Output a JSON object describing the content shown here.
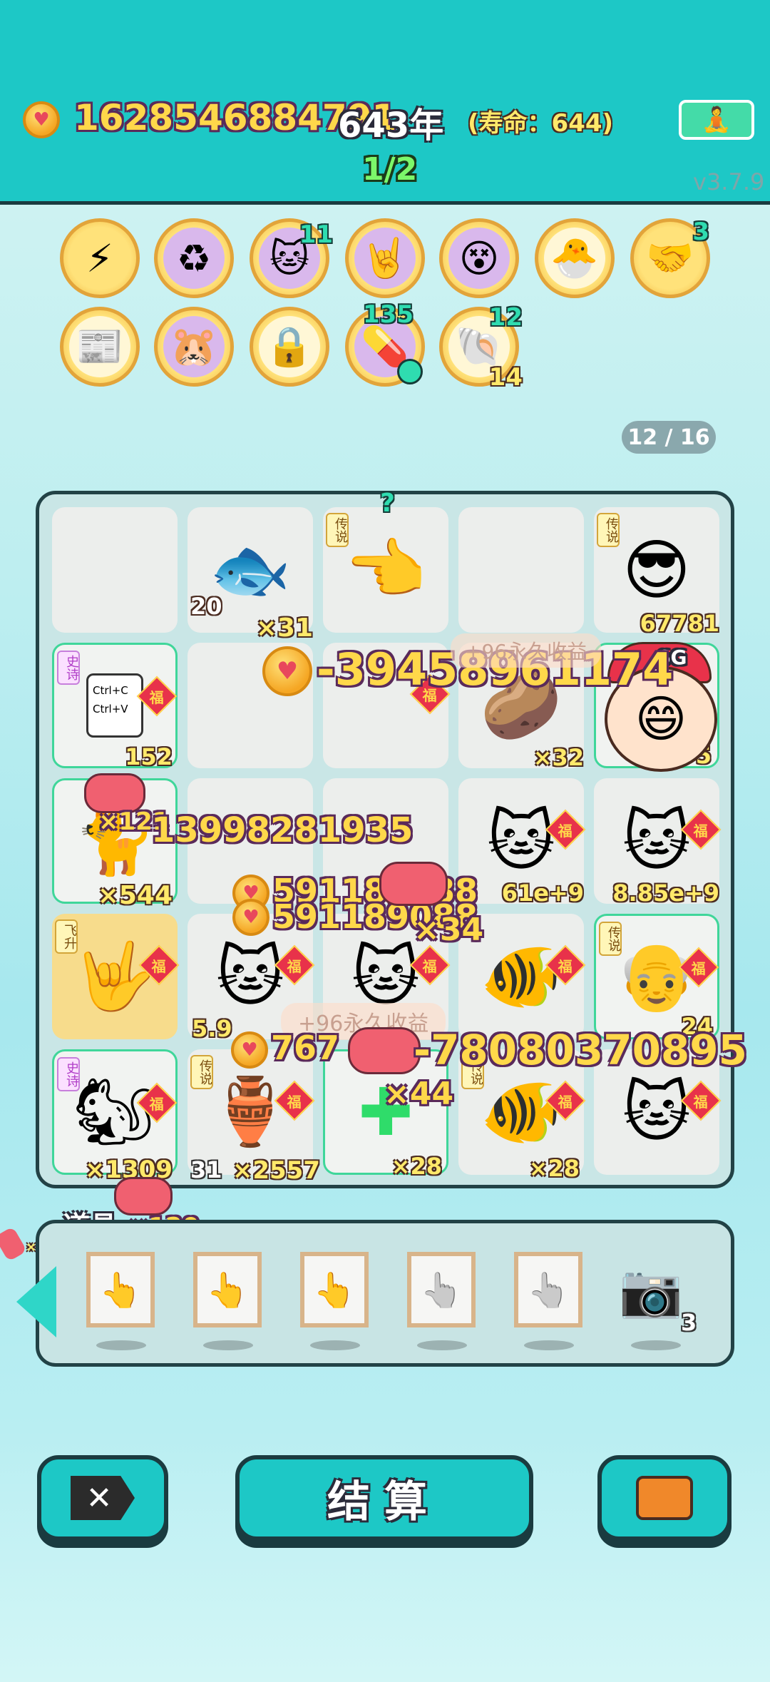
{
  "header": {
    "coins": "1628546884791",
    "years": "643年",
    "lifespan": "(寿命：644)",
    "progress": "1/2",
    "version": "v3.7.9",
    "meditate_icon": "meditate-icon"
  },
  "relics": {
    "row1": [
      {
        "icon": "lightning-icon",
        "count": ""
      },
      {
        "icon": "recycle-icon",
        "count": ""
      },
      {
        "icon": "cat-icon",
        "count": "11"
      },
      {
        "icon": "rock-hand-icon",
        "count": ""
      },
      {
        "icon": "coin-eyes-icon",
        "count": ""
      },
      {
        "icon": "chick-icon",
        "count": ""
      },
      {
        "icon": "handshake-icon",
        "count": "3"
      }
    ],
    "row2": [
      {
        "icon": "time-magazine-icon",
        "count": ""
      },
      {
        "icon": "prairie-dogs-icon",
        "count": ""
      },
      {
        "icon": "safe-icon",
        "count": ""
      },
      {
        "icon": "pill-tray-icon",
        "count": "135"
      },
      {
        "icon": "shell-icon",
        "count_top": "12",
        "count_bottom": "14"
      }
    ]
  },
  "page_indicator": "12 / 16",
  "board": {
    "cells": [
      {
        "label": "",
        "count": ""
      },
      {
        "label": "fish",
        "count": "×31",
        "left_count": "20"
      },
      {
        "label": "hand",
        "tag": "传说",
        "count": "",
        "top": "?"
      },
      {
        "label": "",
        "count": ""
      },
      {
        "label": "man-sunglasses",
        "tag": "传说",
        "count": "67781"
      },
      {
        "label": "ctrl-cv",
        "tag": "史诗",
        "count": "152",
        "text1": "Ctrl+C",
        "text2": "Ctrl+V",
        "fu": "福"
      },
      {
        "label": "",
        "count": ""
      },
      {
        "label": "",
        "count": "",
        "fu": "福"
      },
      {
        "label": "potato",
        "count": "×32"
      },
      {
        "label": "boy-hat",
        "count": "5",
        "hat": "6G"
      },
      {
        "label": "cat",
        "count": "×544"
      },
      {
        "label": "",
        "count": ""
      },
      {
        "label": "",
        "count": ""
      },
      {
        "label": "cat",
        "count": "61e+9",
        "fu": "福"
      },
      {
        "label": "cat",
        "count": "8.85e+9",
        "fu": "福"
      },
      {
        "label": "rock-hand",
        "tag": "飞升",
        "count": "",
        "fu": "福"
      },
      {
        "label": "cat",
        "count": "5.9",
        "fu": "福"
      },
      {
        "label": "cat",
        "count": "",
        "fu": "福"
      },
      {
        "label": "goldfish",
        "count": "",
        "fu": "福"
      },
      {
        "label": "old-man",
        "tag": "传说",
        "count": "24",
        "fu": "福"
      },
      {
        "label": "prairie-dog",
        "tag": "史诗",
        "count": "×1309",
        "fu": "福"
      },
      {
        "label": "vase",
        "tag": "传说",
        "count": "×2557",
        "left_count": "31",
        "fu": "福"
      },
      {
        "label": "plus-clover",
        "count": "×28"
      },
      {
        "label": "goldfish-clover",
        "tag": "传说",
        "count": "×28",
        "fu": "福"
      },
      {
        "label": "cat",
        "count": "",
        "fu": "福"
      }
    ]
  },
  "floating": {
    "big_loss": "-39458961174",
    "small_1": "×121",
    "num_row2": "13998281935",
    "num_a": "591189088",
    "num_b": "591189088",
    "mult_34": "×34",
    "num_c": "767",
    "loss_2": "-78080370895",
    "mult_44": "×44",
    "perm_1": "+96永久收益",
    "perm_2": "+96永久收益"
  },
  "props": {
    "title": "道具",
    "title_count": "×120",
    "count_x2": "×2",
    "camera_count": "3"
  },
  "buttons": {
    "settle": "结算",
    "close_icon": "close-icon",
    "bag_icon": "briefcase-icon"
  },
  "colors": {
    "topbar": "#1dc8c6",
    "gold": "#ffd84a",
    "board_bg": "#c9e6e6"
  }
}
